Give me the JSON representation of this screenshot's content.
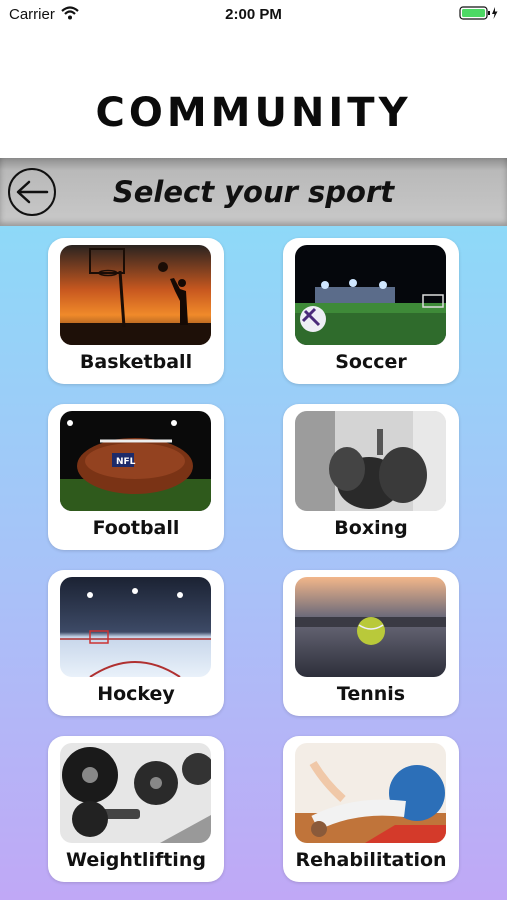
{
  "status_bar": {
    "carrier": "Carrier",
    "time": "2:00 PM"
  },
  "header": {
    "title": "COMMUNITY"
  },
  "subheader": {
    "title": "Select your sport"
  },
  "sports": [
    {
      "label": "Basketball"
    },
    {
      "label": "Soccer"
    },
    {
      "label": "Football"
    },
    {
      "label": "Boxing"
    },
    {
      "label": "Hockey"
    },
    {
      "label": "Tennis"
    },
    {
      "label": "Weightlifting"
    },
    {
      "label": "Rehabilitation"
    }
  ],
  "colors": {
    "battery": "#4cd964",
    "gradient_top": "#8ed9f8",
    "gradient_bottom": "#c0a8f6",
    "subheader_gray": "#c9c9c9"
  }
}
